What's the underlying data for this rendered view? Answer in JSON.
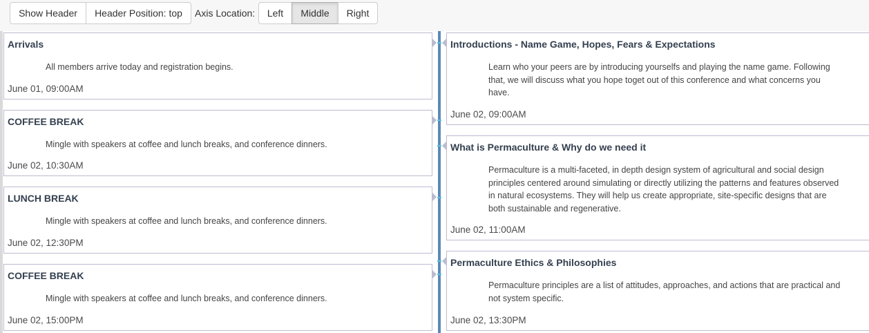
{
  "toolbar": {
    "show_header_label": "Show Header",
    "header_position_label": "Header Position: top",
    "axis_location_label": "Axis Location:",
    "axis_options": [
      "Left",
      "Middle",
      "Right"
    ],
    "axis_selected": "Middle"
  },
  "timeline": {
    "left": [
      {
        "title": "Arrivals",
        "description": "All members arrive today and registration begins.",
        "time": "June 01, 09:00AM"
      },
      {
        "title": "COFFEE BREAK",
        "description": "Mingle with speakers at coffee and lunch breaks, and conference dinners.",
        "time": "June 02, 10:30AM"
      },
      {
        "title": "LUNCH BREAK",
        "description": "Mingle with speakers at coffee and lunch breaks, and conference dinners.",
        "time": "June 02, 12:30PM"
      },
      {
        "title": "COFFEE BREAK",
        "description": "Mingle with speakers at coffee and lunch breaks, and conference dinners.",
        "time": "June 02, 15:00PM"
      }
    ],
    "right": [
      {
        "title": "Introductions - Name Game, Hopes, Fears & Expectations",
        "description": "Learn who your peers are by introducing yourselfs and playing the name game. Following that, we will discuss what you hope toget out of this conference and what concerns you have.",
        "time": "June 02, 09:00AM"
      },
      {
        "title": "What is Permaculture & Why do we need it",
        "description": "Permaculture is a multi-faceted, in depth design system of agricultural and social design principles centered around simulating or directly utilizing the patterns and features observed in natural ecosystems. They will help us create appropriate, site-specific designs that are both sustainable and regenerative.",
        "time": "June 02, 11:00AM"
      },
      {
        "title": "Permaculture Ethics & Philosophies",
        "description": "Permaculture principles are a list of attitudes, approaches, and actions that are practical and not system specific.",
        "time": "June 02, 13:30PM"
      }
    ]
  },
  "colors": {
    "axis": "#5b8ab5",
    "connector": "#5bc0de",
    "card_border": "#bcbcd0",
    "title": "#34404f"
  }
}
